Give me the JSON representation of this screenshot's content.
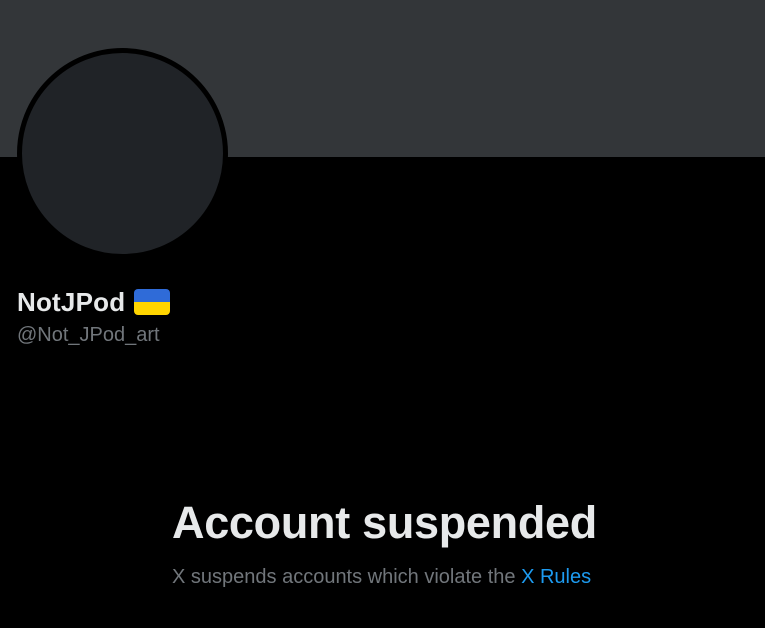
{
  "profile": {
    "display_name": "NotJPod",
    "handle": "@Not_JPod_art",
    "flag_icon": "ukraine-flag-icon",
    "flag_colors": {
      "top": "#2f6bd8",
      "bottom": "#ffd500"
    }
  },
  "colors": {
    "background": "#000000",
    "banner": "#333639",
    "avatar": "#202327",
    "primary_text": "#e7e9ea",
    "secondary_text": "#71767b",
    "link": "#1d9bf0"
  },
  "notice": {
    "title": "Account suspended",
    "description": "X suspends accounts which violate the ",
    "link_label": "X Rules"
  }
}
